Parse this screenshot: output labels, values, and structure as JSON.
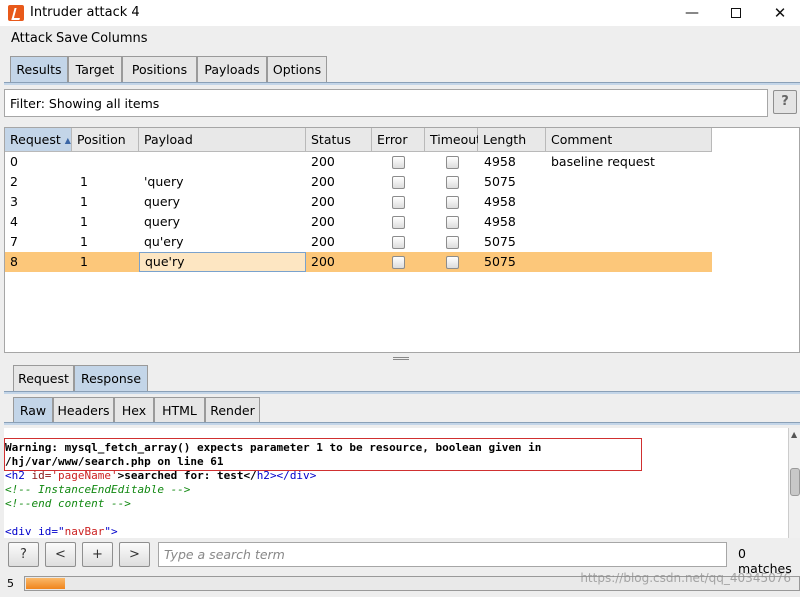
{
  "window": {
    "title": "Intruder attack 4"
  },
  "menu": {
    "attack": "Attack",
    "save": "Save",
    "columns": "Columns"
  },
  "tabs": [
    "Results",
    "Target",
    "Positions",
    "Payloads",
    "Options"
  ],
  "filter": {
    "text": "Filter: Showing all items",
    "help": "?"
  },
  "table": {
    "headers": [
      "Request",
      "Position",
      "Payload",
      "Status",
      "Error",
      "Timeout",
      "Length",
      "Comment"
    ],
    "sort_arrow": "▲",
    "rows": [
      {
        "request": "0",
        "position": "",
        "payload": "",
        "status": "200",
        "length": "4958",
        "comment": "baseline request"
      },
      {
        "request": "2",
        "position": "1",
        "payload": "'query",
        "status": "200",
        "length": "5075",
        "comment": ""
      },
      {
        "request": "3",
        "position": "1",
        "payload": "query",
        "status": "200",
        "length": "4958",
        "comment": ""
      },
      {
        "request": "4",
        "position": "1",
        "payload": "query",
        "status": "200",
        "length": "4958",
        "comment": ""
      },
      {
        "request": "7",
        "position": "1",
        "payload": "qu'ery",
        "status": "200",
        "length": "5075",
        "comment": ""
      },
      {
        "request": "8",
        "position": "1",
        "payload": "que'ry",
        "status": "200",
        "length": "5075",
        "comment": ""
      }
    ],
    "selected_row": "8"
  },
  "reqres_tabs": [
    "Request",
    "Response"
  ],
  "view_tabs": [
    "Raw",
    "Headers",
    "Hex",
    "HTML",
    "Render"
  ],
  "response": {
    "warning_line1": "Warning: mysql_fetch_array() expects parameter 1 to be resource, boolean given in",
    "warning_line2": "/hj/var/www/search.php on line 61",
    "l3_open": "<",
    "l3_tag": "h2",
    "l3_attr": " id=",
    "l3_str": "'pageName'",
    "l3_text": ">searched for: test</",
    "l3_tag2": "h2",
    "l3_mid": "></",
    "l3_tag3": "div",
    "l3_close": ">",
    "comment1": "<!-- InstanceEndEditable -->",
    "comment2": "<!--end content -->",
    "l6_open": "<div id=\"",
    "l6_str": "navBar",
    "l6_close": "\">"
  },
  "search": {
    "btn_help": "?",
    "btn_prev": "<",
    "btn_add": "+",
    "btn_next": ">",
    "placeholder": "Type a search term",
    "matches": "0 matches"
  },
  "status": {
    "count": "5",
    "progress": 0.05
  },
  "watermark": "https://blog.csdn.net/qq_40345076",
  "colors": {
    "selection": "#fcc77a",
    "active_tab": "#c3d5e8",
    "progress": "#f0851c",
    "warning_box": "#d03030"
  }
}
